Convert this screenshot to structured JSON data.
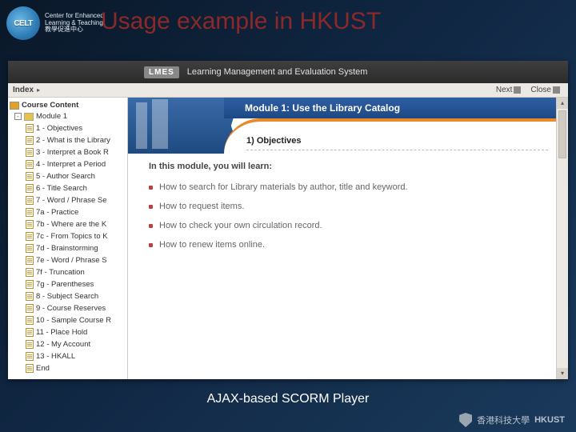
{
  "slide": {
    "title": "Usage example in HKUST",
    "caption": "AJAX-based SCORM Player"
  },
  "celt": {
    "abbr": "CELT",
    "line1": "Center for Enhanced",
    "line2": "Learning & Teaching",
    "cn": "教學促進中心"
  },
  "hkust": {
    "cn": "香港科技大學",
    "en": "HKUST"
  },
  "lmes": {
    "brand": "LMES",
    "tagline": "Learning Management and Evaluation System"
  },
  "toolbar": {
    "index": "Index",
    "next": "Next",
    "close": "Close"
  },
  "tree": {
    "root": "Course Content",
    "module": "Module 1",
    "items": [
      "1 - Objectives",
      "2 - What is the Library",
      "3 - Interpret a Book R",
      "4 - Interpret a Period",
      "5 - Author Search",
      "6 - Title Search",
      "7 - Word / Phrase Se",
      "7a - Practice",
      "7b - Where are the K",
      "7c - From Topics to K",
      "7d - Brainstorming",
      "7e - Word / Phrase S",
      "7f - Truncation",
      "7g - Parentheses",
      "8 - Subject Search",
      "9 - Course Reserves",
      "10 - Sample Course R",
      "11 - Place Hold",
      "12 - My Account",
      "13 - HKALL",
      "End"
    ]
  },
  "content": {
    "module_title": "Module 1: Use the Library Catalog",
    "section": "1) Objectives",
    "lead": "In this module, you will learn:",
    "bullets": [
      "How to search for Library materials by author, title and keyword.",
      "How to request items.",
      "How to check your own circulation record.",
      "How to renew items online."
    ]
  }
}
